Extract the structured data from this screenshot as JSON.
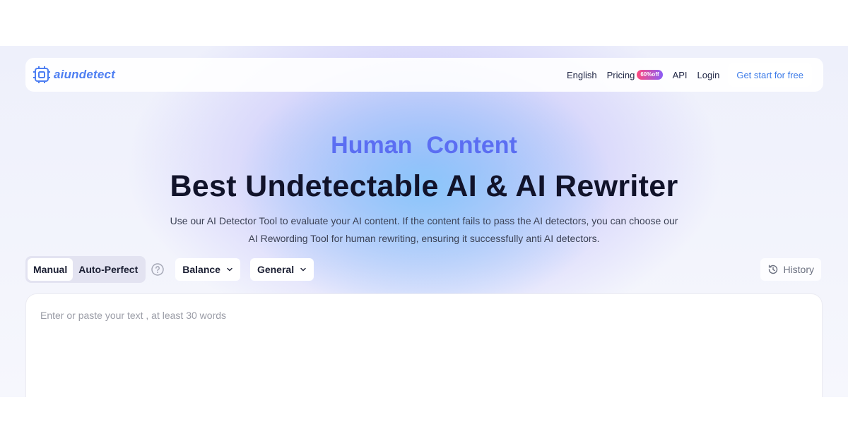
{
  "brand": {
    "name": "aiundetect",
    "color": "#4d7ef2"
  },
  "nav": {
    "language": "English",
    "pricing": "Pricing",
    "pricing_badge": "60%off",
    "api": "API",
    "login": "Login",
    "cta": "Get start for free"
  },
  "hero": {
    "subtitle_word1": "Human",
    "subtitle_word2": "Content",
    "title": "Best Undetectable AI & AI Rewriter",
    "description_line1": "Use our AI Detector Tool to evaluate your AI content. If the content fails to pass the AI detectors, you can choose our",
    "description_line2": "AI Rewording Tool for human rewriting, ensuring it successfully anti AI detectors."
  },
  "controls": {
    "modes": [
      "Manual",
      "Auto-Perfect"
    ],
    "active_mode": "Manual",
    "strength_select": "Balance",
    "purpose_select": "General",
    "history": "History",
    "icons": {
      "help": "question-circle-icon",
      "history": "history-clock-icon",
      "chevron": "chevron-down-icon"
    }
  },
  "editor": {
    "placeholder": "Enter or paste your text , at least 30 words",
    "value": ""
  },
  "colors": {
    "accent": "#5b6ef2",
    "cta_text": "#3b7ae8",
    "badge_from": "#ff4a7d",
    "badge_to": "#8b5cf6"
  }
}
